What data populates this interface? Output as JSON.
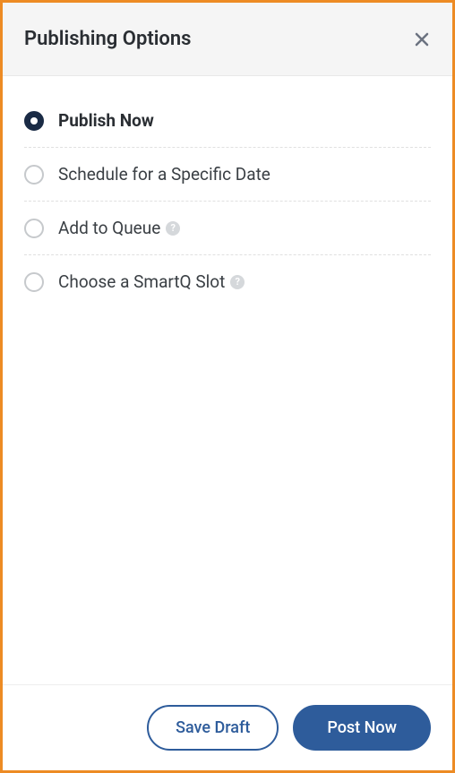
{
  "header": {
    "title": "Publishing Options"
  },
  "options": [
    {
      "label": "Publish Now",
      "selected": true,
      "help": false
    },
    {
      "label": "Schedule for a Specific Date",
      "selected": false,
      "help": false
    },
    {
      "label": "Add to Queue",
      "selected": false,
      "help": true
    },
    {
      "label": "Choose a SmartQ Slot",
      "selected": false,
      "help": true
    }
  ],
  "footer": {
    "save_draft_label": "Save Draft",
    "post_now_label": "Post Now"
  }
}
